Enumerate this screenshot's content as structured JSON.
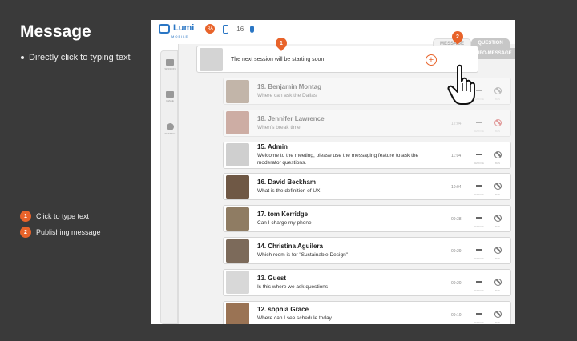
{
  "page": {
    "title": "Message",
    "bullet": "Directly click to typing text",
    "legend": [
      {
        "num": "1",
        "label": "Click to type text"
      },
      {
        "num": "2",
        "label": "Publishing message"
      }
    ]
  },
  "app": {
    "logo": {
      "name": "Lumi",
      "sub": "MOBILE"
    },
    "badge": "RA",
    "count": "16",
    "tabs": {
      "message": "MESSAGE",
      "question": "QUESTION",
      "info": "INFO-MESSAGE"
    },
    "sidebar": [
      {
        "icon": "folder-icon",
        "label": "SESSION"
      },
      {
        "icon": "camera-icon",
        "label": "IMAGE"
      },
      {
        "icon": "gear-icon",
        "label": "SETTING"
      }
    ],
    "compose": {
      "text": "The next session will be starting soon"
    },
    "action_labels": {
      "dash": "REMOVE",
      "ban": "BAN"
    },
    "messages": [
      {
        "name": "19. Benjamin Montag",
        "text": "Where can ask the Dallas",
        "time": "",
        "faded": true,
        "avatar": "#8a6c52",
        "ban": "normal"
      },
      {
        "name": "18. Jennifer Lawrence",
        "text": "When's break time",
        "time": "12:04",
        "faded": true,
        "avatar": "#a25a47",
        "ban": "red"
      },
      {
        "name": "15. Admin",
        "text": "Welcome to the meeting, please use the messaging feature to ask the moderator questions.",
        "time": "11:04",
        "faded": false,
        "avatar": "#cfcfcf",
        "ban": "normal"
      },
      {
        "name": "16. David Beckham",
        "text": "What is the definition of UX",
        "time": "10:04",
        "faded": false,
        "avatar": "#6f5845",
        "ban": "normal"
      },
      {
        "name": "17. tom Kerridge",
        "text": "Can I charge my phone",
        "time": "09:38",
        "faded": false,
        "avatar": "#8f7c63",
        "ban": "normal"
      },
      {
        "name": "14. Christina Aguilera",
        "text": "Which room is for \"Sustainable Design\"",
        "time": "09:29",
        "faded": false,
        "avatar": "#7c6a5a",
        "ban": "normal"
      },
      {
        "name": "13. Guest",
        "text": "Is this where we ask questions",
        "time": "09:20",
        "faded": false,
        "avatar": "#d8d8d8",
        "ban": "normal"
      },
      {
        "name": "12. sophia Grace",
        "text": "Where can I see schedule today",
        "time": "09:10",
        "faded": false,
        "avatar": "#9a7354",
        "ban": "normal"
      }
    ],
    "pins": [
      "1",
      "2"
    ]
  }
}
